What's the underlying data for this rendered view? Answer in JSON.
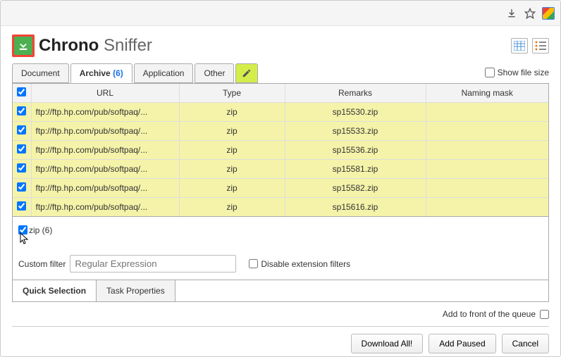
{
  "app": {
    "title_bold": "Chrono",
    "title_light": "Sniffer"
  },
  "tabs": {
    "document": "Document",
    "archive": "Archive",
    "archive_count": "(6)",
    "application": "Application",
    "other": "Other"
  },
  "show_file_size": "Show file size",
  "table": {
    "headers": {
      "url": "URL",
      "type": "Type",
      "remarks": "Remarks",
      "mask": "Naming mask"
    },
    "rows": [
      {
        "url": "ftp://ftp.hp.com/pub/softpaq/...",
        "type": "zip",
        "remarks": "sp15530.zip",
        "mask": ""
      },
      {
        "url": "ftp://ftp.hp.com/pub/softpaq/...",
        "type": "zip",
        "remarks": "sp15533.zip",
        "mask": ""
      },
      {
        "url": "ftp://ftp.hp.com/pub/softpaq/...",
        "type": "zip",
        "remarks": "sp15536.zip",
        "mask": ""
      },
      {
        "url": "ftp://ftp.hp.com/pub/softpaq/...",
        "type": "zip",
        "remarks": "sp15581.zip",
        "mask": ""
      },
      {
        "url": "ftp://ftp.hp.com/pub/softpaq/...",
        "type": "zip",
        "remarks": "sp15582.zip",
        "mask": ""
      },
      {
        "url": "ftp://ftp.hp.com/pub/softpaq/...",
        "type": "zip",
        "remarks": "sp15616.zip",
        "mask": ""
      }
    ]
  },
  "filters": {
    "zip": "zip (6)",
    "custom_label": "Custom filter",
    "custom_placeholder": "Regular Expression",
    "disable_ext": "Disable extension filters"
  },
  "bottom_tabs": {
    "quick": "Quick Selection",
    "task": "Task Properties"
  },
  "footer": {
    "add_front": "Add to front of the queue",
    "download_all": "Download All!",
    "add_paused": "Add Paused",
    "cancel": "Cancel"
  }
}
